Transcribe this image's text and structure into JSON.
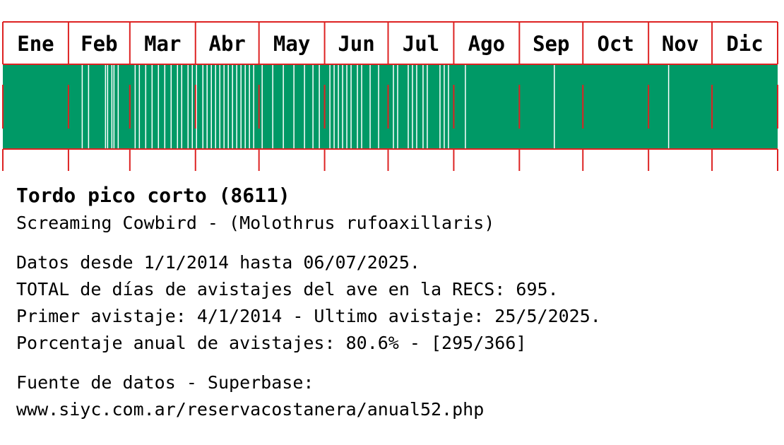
{
  "colors": {
    "presence": "#009966",
    "absence": "#ffffff",
    "divider": "#dd2222",
    "text": "#000000"
  },
  "chart_data": {
    "type": "heatmap",
    "title": "",
    "xlabel": "",
    "ylabel": "",
    "months": [
      "Ene",
      "Feb",
      "Mar",
      "Abr",
      "May",
      "Jun",
      "Jul",
      "Ago",
      "Sep",
      "Oct",
      "Nov",
      "Dic"
    ],
    "days_per_month": [
      31,
      29,
      31,
      30,
      31,
      30,
      31,
      31,
      30,
      31,
      30,
      31
    ],
    "days_with_sightings": 295,
    "days_total": 366,
    "days_without_sightings": [
      [
        2,
        7
      ],
      [
        2,
        10
      ],
      [
        2,
        18
      ],
      [
        2,
        19
      ],
      [
        2,
        21
      ],
      [
        2,
        22
      ],
      [
        2,
        24
      ],
      [
        3,
        3
      ],
      [
        3,
        5
      ],
      [
        3,
        8
      ],
      [
        3,
        11
      ],
      [
        3,
        14
      ],
      [
        3,
        17
      ],
      [
        3,
        20
      ],
      [
        3,
        23
      ],
      [
        3,
        25
      ],
      [
        3,
        28
      ],
      [
        3,
        30
      ],
      [
        4,
        1
      ],
      [
        4,
        4
      ],
      [
        4,
        6
      ],
      [
        4,
        8
      ],
      [
        4,
        10
      ],
      [
        4,
        12
      ],
      [
        4,
        14
      ],
      [
        4,
        16
      ],
      [
        4,
        18
      ],
      [
        4,
        20
      ],
      [
        4,
        22
      ],
      [
        4,
        24
      ],
      [
        4,
        26
      ],
      [
        4,
        28
      ],
      [
        5,
        2
      ],
      [
        5,
        7
      ],
      [
        5,
        12
      ],
      [
        5,
        17
      ],
      [
        5,
        22
      ],
      [
        5,
        26
      ],
      [
        5,
        29
      ],
      [
        6,
        3
      ],
      [
        6,
        5
      ],
      [
        6,
        7
      ],
      [
        6,
        9
      ],
      [
        6,
        11
      ],
      [
        6,
        13
      ],
      [
        6,
        16
      ],
      [
        6,
        18
      ],
      [
        6,
        22
      ],
      [
        6,
        26
      ],
      [
        7,
        3
      ],
      [
        7,
        5
      ],
      [
        7,
        10
      ],
      [
        7,
        12
      ],
      [
        7,
        14
      ],
      [
        7,
        17
      ],
      [
        7,
        19
      ],
      [
        7,
        25
      ],
      [
        7,
        27
      ],
      [
        7,
        29
      ],
      [
        8,
        6
      ],
      [
        9,
        17
      ],
      [
        11,
        10
      ]
    ]
  },
  "species": {
    "common_name": "Tordo pico corto (8611)",
    "english_scientific": "Screaming Cowbird - (Molothrus rufoaxillaris)"
  },
  "stats": {
    "range": "Datos desde 1/1/2014 hasta 06/07/2025.",
    "total": "TOTAL de días de avistajes del ave en la RECS: 695.",
    "first_last": "Primer avistaje: 4/1/2014 - Ultimo avistaje: 25/5/2025.",
    "percent": "Porcentaje anual de avistajes: 80.6% - [295/366]"
  },
  "source": {
    "label": "Fuente de datos - Superbase:",
    "url": "www.siyc.com.ar/reservacostanera/anual52.php"
  }
}
